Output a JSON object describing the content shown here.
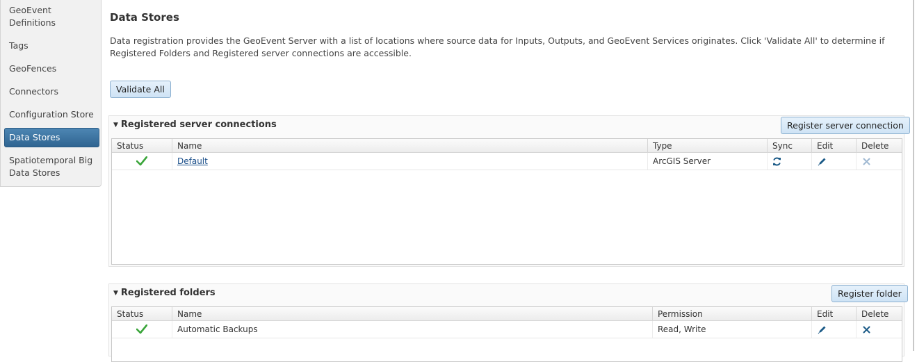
{
  "sidebar": {
    "items": [
      {
        "label": "GeoEvent\nDefinitions"
      },
      {
        "label": "Tags"
      },
      {
        "label": "GeoFences"
      },
      {
        "label": "Connectors"
      },
      {
        "label": "Configuration Store"
      },
      {
        "label": "Data Stores",
        "active": true
      },
      {
        "label": "Spatiotemporal Big\nData Stores"
      }
    ]
  },
  "main": {
    "title": "Data Stores",
    "description": "Data registration provides the GeoEvent Server with a list of locations where source data for Inputs, Outputs, and GeoEvent Services originates. Click 'Validate All' to determine if Registered Folders and Registered server connections are accessible.",
    "validate_all_label": "Validate All"
  },
  "server_connections": {
    "title": "Registered server connections",
    "register_button": "Register server connection",
    "columns": [
      "Status",
      "Name",
      "Type",
      "Sync",
      "Edit",
      "Delete"
    ],
    "rows": [
      {
        "status": "valid",
        "name": "Default",
        "type": "ArcGIS Server"
      }
    ]
  },
  "folders": {
    "title": "Registered folders",
    "register_button": "Register folder",
    "columns": [
      "Status",
      "Name",
      "Permission",
      "Edit",
      "Delete"
    ],
    "rows": [
      {
        "status": "valid",
        "name": "Automatic Backups",
        "permission": "Read, Write"
      }
    ]
  },
  "colors": {
    "accent": "#2f6491",
    "check": "#3aa53a",
    "icon_blue": "#1b5a87"
  }
}
